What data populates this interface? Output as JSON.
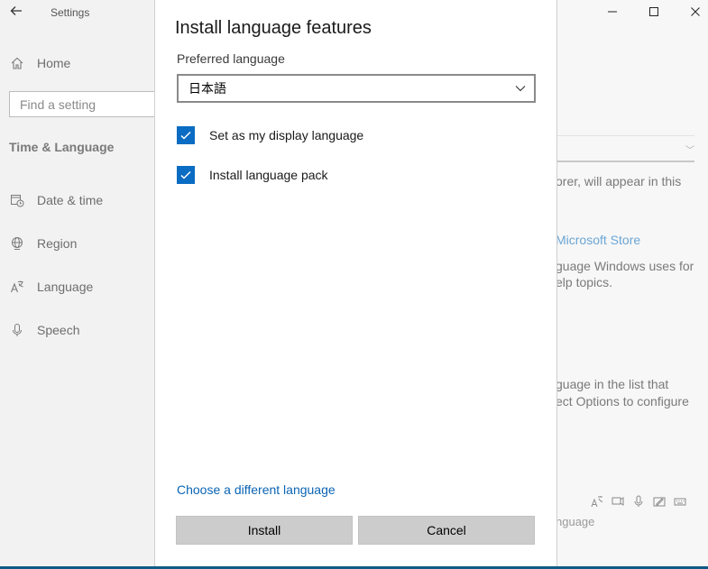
{
  "app": {
    "title": "Settings"
  },
  "sidebar": {
    "home_label": "Home",
    "search_placeholder": "Find a setting",
    "section_title": "Time & Language",
    "items": [
      {
        "label": "Date & time",
        "icon": "calendar-clock-icon"
      },
      {
        "label": "Region",
        "icon": "globe-icon"
      },
      {
        "label": "Language",
        "icon": "language-icon"
      },
      {
        "label": "Speech",
        "icon": "microphone-icon"
      }
    ]
  },
  "background": {
    "line1": "orer, will appear in this",
    "store_link": "Microsoft Store",
    "line2": "guage Windows uses for",
    "line3": "elp topics.",
    "line4": "guage in the list that",
    "line5": "ect Options to configure",
    "line6": "nguage"
  },
  "dialog": {
    "title": "Install language features",
    "preferred_label": "Preferred language",
    "selected_language": "日本語",
    "options": [
      {
        "label": "Set as my display language",
        "checked": true
      },
      {
        "label": "Install language pack",
        "checked": true
      }
    ],
    "change_link": "Choose a different language",
    "install_label": "Install",
    "cancel_label": "Cancel"
  },
  "colors": {
    "accent": "#0a6cc2",
    "link": "#0a64b4",
    "taskbar": "#0f5a86"
  }
}
